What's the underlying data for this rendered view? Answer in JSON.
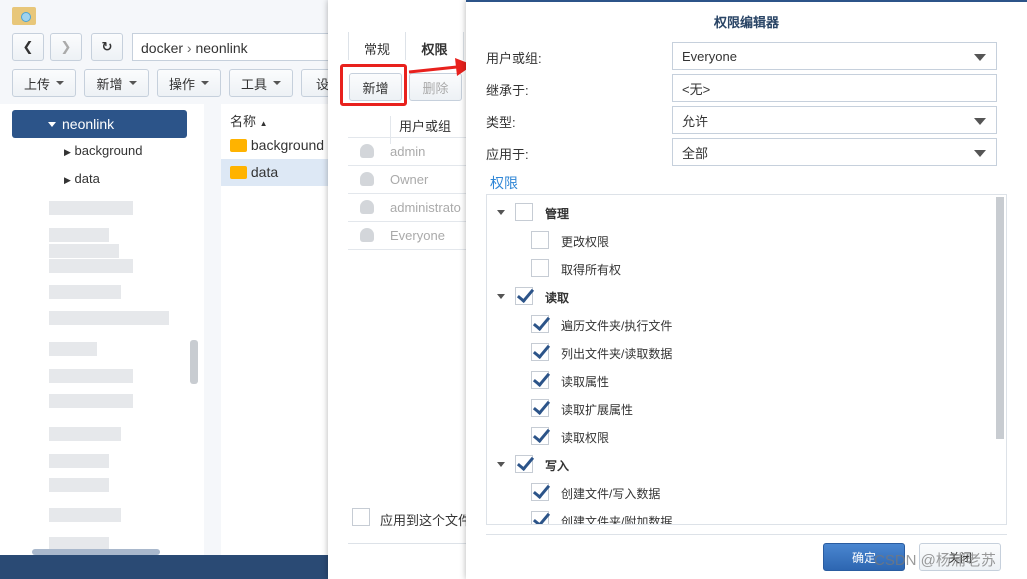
{
  "file_station": {
    "path": [
      "docker",
      "neonlink"
    ],
    "toolbar": [
      "上传",
      "新增",
      "操作",
      "工具",
      "设"
    ],
    "tree": {
      "selected": "neonlink",
      "children": [
        "background",
        "data"
      ]
    },
    "list": {
      "header": "名称",
      "rows": [
        "background",
        "data"
      ],
      "selected": "data"
    }
  },
  "properties": {
    "tabs": [
      "常规",
      "权限"
    ],
    "active_tab": "权限",
    "buttons": {
      "add": "新增",
      "delete": "删除"
    },
    "table_header": "用户或组",
    "rows": [
      "admin",
      "Owner",
      "administrato",
      "Everyone"
    ],
    "apply_label": "应用到这个文件夹"
  },
  "editor": {
    "title": "权限编辑器",
    "fields": [
      {
        "label": "用户或组:",
        "value": "Everyone",
        "dropdown": true
      },
      {
        "label": "继承于:",
        "value": "<无>",
        "dropdown": false
      },
      {
        "label": "类型:",
        "value": "允许",
        "dropdown": true
      },
      {
        "label": "应用于:",
        "value": "全部",
        "dropdown": true
      }
    ],
    "section": "权限",
    "permissions": [
      {
        "label": "管理",
        "group": true,
        "checked": false
      },
      {
        "label": "更改权限",
        "group": false,
        "checked": false
      },
      {
        "label": "取得所有权",
        "group": false,
        "checked": false
      },
      {
        "label": "读取",
        "group": true,
        "checked": true
      },
      {
        "label": "遍历文件夹/执行文件",
        "group": false,
        "checked": true
      },
      {
        "label": "列出文件夹/读取数据",
        "group": false,
        "checked": true
      },
      {
        "label": "读取属性",
        "group": false,
        "checked": true
      },
      {
        "label": "读取扩展属性",
        "group": false,
        "checked": true
      },
      {
        "label": "读取权限",
        "group": false,
        "checked": true
      },
      {
        "label": "写入",
        "group": true,
        "checked": true
      },
      {
        "label": "创建文件/写入数据",
        "group": false,
        "checked": true
      },
      {
        "label": "创建文件夹/附加数据",
        "group": false,
        "checked": true
      }
    ],
    "ok": "确定",
    "close": "关闭"
  },
  "watermark": "CSDN @杨浦老苏",
  "colors": {
    "accent": "#2c5489",
    "highlight": "#dde8f5",
    "annotation": "#e8211d",
    "link": "#2f86d6"
  }
}
